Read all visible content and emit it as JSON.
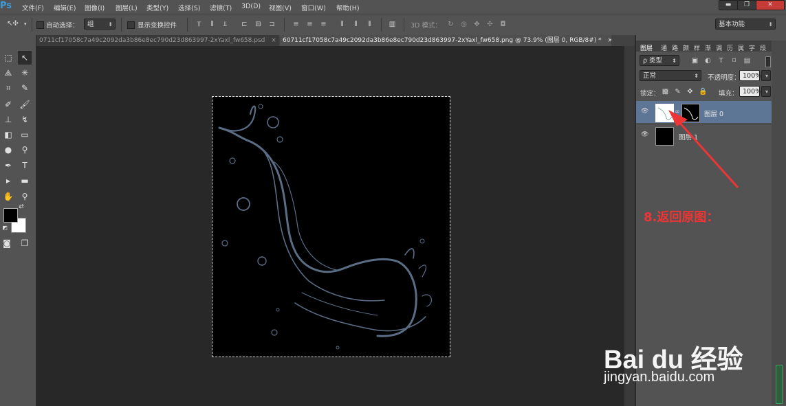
{
  "app": {
    "logo": "Ps"
  },
  "menu": [
    "文件(F)",
    "编辑(E)",
    "图像(I)",
    "图层(L)",
    "类型(Y)",
    "选择(S)",
    "滤镜(T)",
    "3D(D)",
    "视图(V)",
    "窗口(W)",
    "帮助(H)"
  ],
  "window_controls": {
    "minimize": "▬",
    "restore": "❐",
    "close": "✕"
  },
  "options": {
    "move_icon": "↖✣",
    "auto_select_label": "自动选择：",
    "auto_select_value": "组",
    "show_transform_label": "显示变换控件",
    "mode_3d_label": "3D 模式：",
    "workspace_value": "基本功能"
  },
  "tabs": [
    {
      "label": "0711cf17058c7a49c2092da3b86e8ec790d23d863997-2xYaxl_fw658.psd",
      "close": "×"
    },
    {
      "label": "60711cf17058c7a49c2092da3b86e8ec790d23d863997-2xYaxl_fw658.png @ 73.9% (图层 0, RGB/8#) *",
      "close": "×"
    }
  ],
  "layers_panel": {
    "tabs": [
      "图层",
      "通",
      "路",
      "颜",
      "样",
      "渐",
      "调",
      "历",
      "属",
      "字",
      "段"
    ],
    "filter_label": "ρ 类型",
    "blend_mode": "正常",
    "opacity_label": "不透明度：",
    "opacity_value": "100%",
    "lock_label": "锁定：",
    "fill_label": "填充：",
    "fill_value": "100%",
    "layers": [
      {
        "name": "图层 0",
        "selected": true
      },
      {
        "name": "图层 1",
        "selected": false
      }
    ]
  },
  "annotation": {
    "text": "8.返回原图：",
    "color": "#ee3535"
  },
  "watermark": {
    "brand": "Bai du 经验",
    "url": "jingyan.baidu.com"
  },
  "colors": {
    "panel": "#535353",
    "canvas_bg": "#282828",
    "selected_layer": "#5e7696",
    "accent": "#3d9bd9"
  }
}
